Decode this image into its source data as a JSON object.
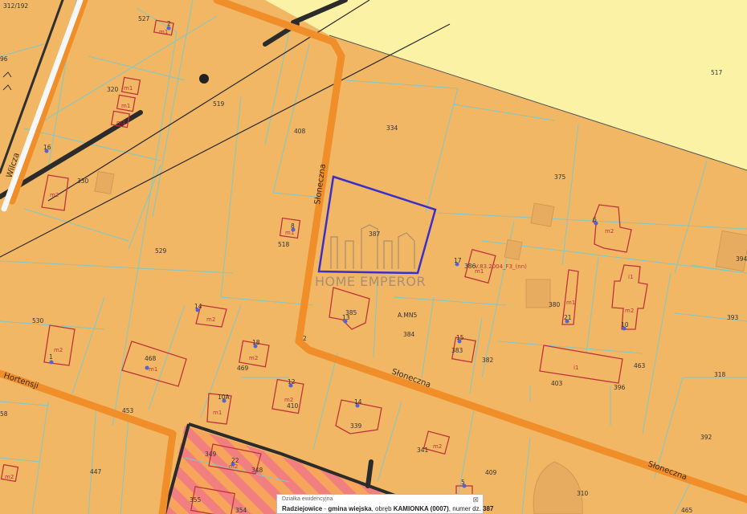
{
  "colors": {
    "parcel_fill": "#f1b765",
    "other_zone_fill": "#fbf2a6",
    "parcel_border": "#7ec9c9",
    "road": "#f08f2a",
    "building_outline": "#c0333a",
    "selection": "#3b2fc7",
    "address_dot": "#5562d6"
  },
  "streets": {
    "sloneczna_a": "Słoneczna",
    "sloneczna_b": "Słoneczna",
    "sloneczna_c": "Słoneczna",
    "wilcza": "Wilcza",
    "hortensji": "Hortensji"
  },
  "parcels": {
    "p312": "312/192",
    "p527": "527",
    "p519": "519",
    "p320": "320",
    "p330": "330",
    "p96": "96",
    "p408": "408",
    "p334": "334",
    "p375": "375",
    "p517": "517",
    "p387": "387",
    "p518": "518",
    "p529": "529",
    "p530": "530",
    "p386": "386",
    "p380": "380",
    "p394": "394",
    "p393": "393",
    "p385": "385",
    "p384": "384",
    "p382": "382",
    "p383": "383",
    "p468": "468",
    "p469": "469",
    "p403": "403",
    "p396": "396",
    "p463": "463",
    "p318": "318",
    "p453": "453",
    "p410": "410",
    "p339": "339",
    "p58": "58",
    "p392": "392",
    "p447": "447",
    "p349": "349",
    "p348": "348",
    "p341": "341",
    "p409": "409",
    "p310": "310",
    "p355": "355",
    "p354": "354",
    "p465": "465",
    "p2": "2",
    "pamns": "A.MN5",
    "annotation": "V.83.2004_F3_(nn)"
  },
  "buildings": {
    "b_m1_a": "m1",
    "b_m1_b": "m1",
    "b_m1_c": "m1",
    "b_m1_d": "m1",
    "b_m1_e": "m1",
    "b_m1_f": "m1",
    "b_m1_g": "m1",
    "b_m1_h": "m1",
    "b_m1_i": "m1",
    "b_m2_a": "m2",
    "b_m2_b": "m2",
    "b_m2_c": "m2",
    "b_m2_d": "m2",
    "b_m2_e": "m2",
    "b_m2_f": "m2",
    "b_m2_g": "m2",
    "b_m2_h": "m2",
    "b_m2_i": "m2",
    "b_m2_j": "m2",
    "b_i1_a": "i1",
    "b_i1_b": "i1"
  },
  "addresses": {
    "a2": "2",
    "a16": "16",
    "a8": "8",
    "a17": "17",
    "a13": "13",
    "a14a": "14",
    "a15": "15",
    "a21": "21",
    "a10": "10",
    "a18": "18",
    "a10a": "10A",
    "a12": "12",
    "a14b": "14",
    "a6": "6",
    "a22": "22",
    "a1": "1",
    "a5": "5"
  },
  "watermark": "HOME EMPEROR",
  "info_panel": {
    "title": "Działka ewidencyjna",
    "close": "⊠",
    "line_b1": "Radziejowice",
    "line_t1": " - ",
    "line_b2": "gmina wiejska",
    "line_t2": ", obręb ",
    "line_b3": "KAMIONKA (0007)",
    "line_t3": ", numer dz. ",
    "line_b4": "387"
  }
}
